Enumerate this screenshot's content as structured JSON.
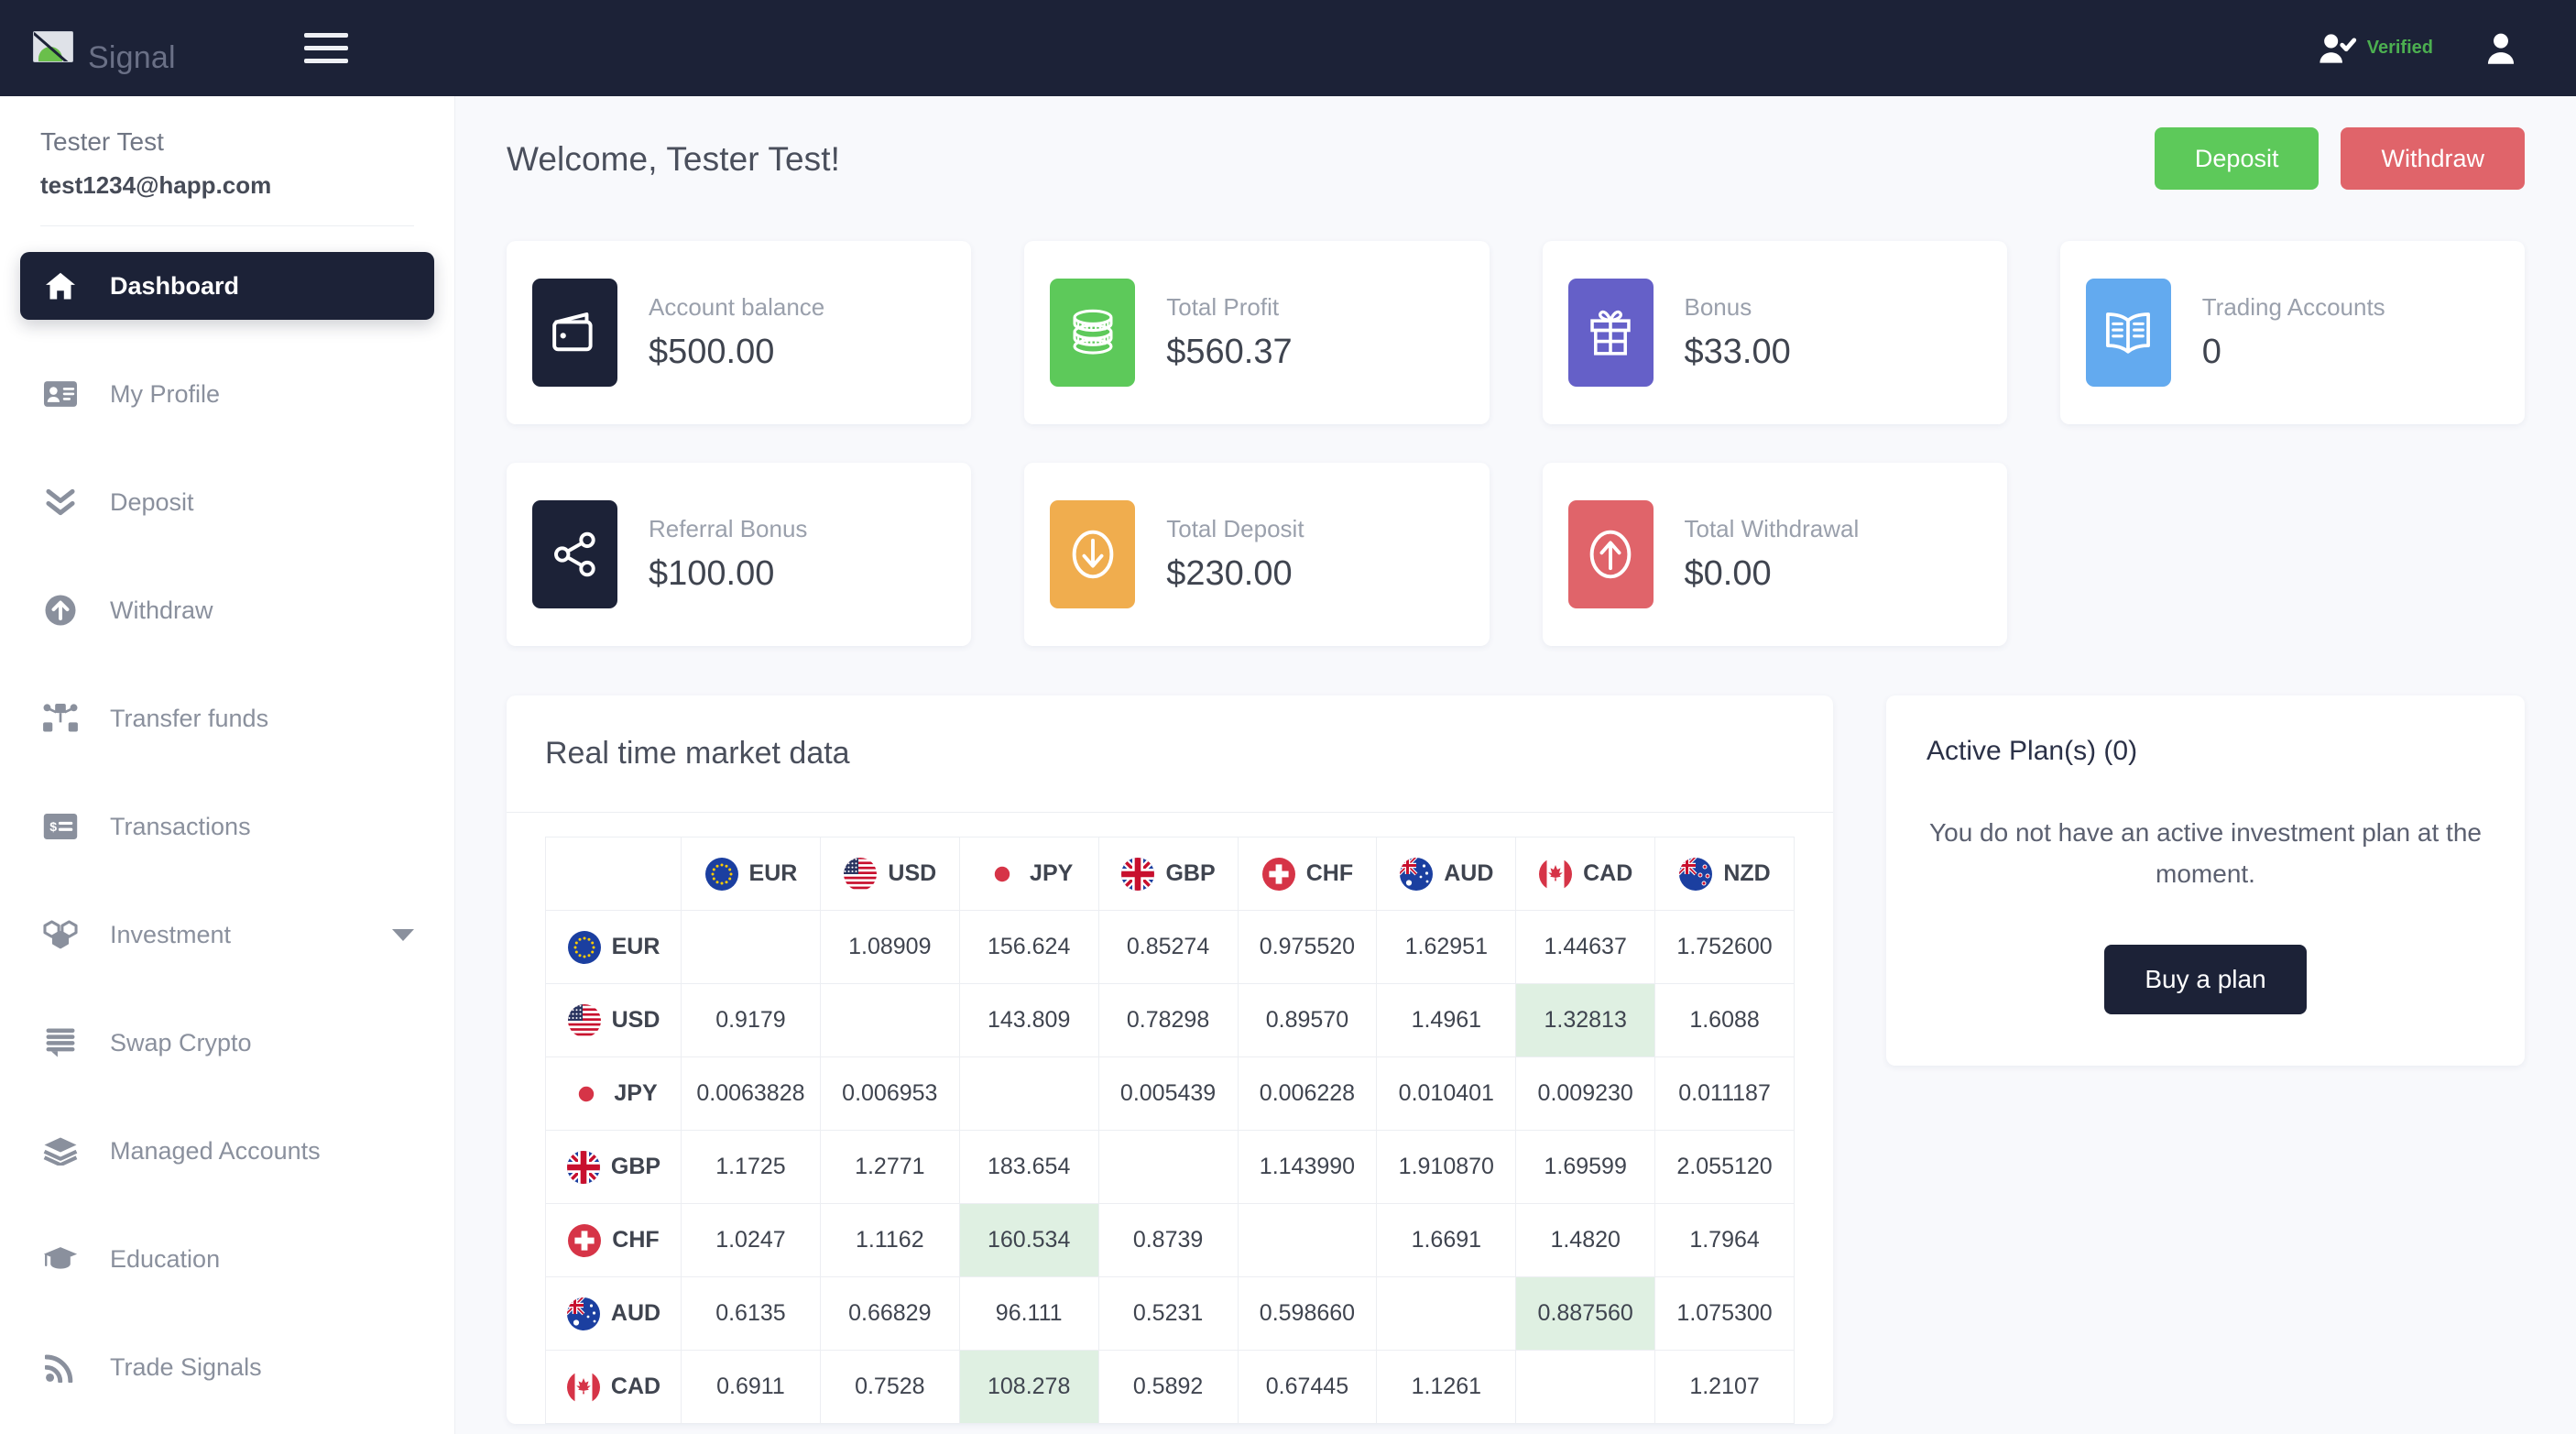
{
  "topbar": {
    "logo_alt": "Signal",
    "logo_icon": "broken-image-icon",
    "menu_icon": "hamburger-menu-icon",
    "verified_label": "Verified",
    "verified_icon": "user-check-icon",
    "account_icon": "user-account-icon"
  },
  "sidebar": {
    "user_name": "Tester Test",
    "user_email": "test1234@happ.com",
    "items": [
      {
        "label": "Dashboard",
        "icon": "home-icon",
        "active": true,
        "caret": false
      },
      {
        "label": "My Profile",
        "icon": "id-card-icon",
        "active": false,
        "caret": false
      },
      {
        "label": "Deposit",
        "icon": "chevrons-down-icon",
        "active": false,
        "caret": false
      },
      {
        "label": "Withdraw",
        "icon": "arrow-up-circle-icon",
        "active": false,
        "caret": false
      },
      {
        "label": "Transfer funds",
        "icon": "transfer-nodes-icon",
        "active": false,
        "caret": false
      },
      {
        "label": "Transactions",
        "icon": "money-card-icon",
        "active": false,
        "caret": false
      },
      {
        "label": "Investment",
        "icon": "boxes-icon",
        "active": false,
        "caret": true
      },
      {
        "label": "Swap Crypto",
        "icon": "stacked-lines-icon",
        "active": false,
        "caret": false
      },
      {
        "label": "Managed Accounts",
        "icon": "layers-icon",
        "active": false,
        "caret": false
      },
      {
        "label": "Education",
        "icon": "graduation-cap-icon",
        "active": false,
        "caret": false
      },
      {
        "label": "Trade Signals",
        "icon": "rss-signal-icon",
        "active": false,
        "caret": false
      }
    ]
  },
  "header": {
    "welcome": "Welcome, Tester Test!",
    "deposit_label": "Deposit",
    "withdraw_label": "Withdraw",
    "deposit_color": "#5dc95a",
    "withdraw_color": "#e0646a"
  },
  "stats": [
    {
      "label": "Account balance",
      "value": "$500.00",
      "icon": "wallet-icon",
      "color": "#1c2237"
    },
    {
      "label": "Total Profit",
      "value": "$560.37",
      "icon": "coins-icon",
      "color": "#5dc95a"
    },
    {
      "label": "Bonus",
      "value": "$33.00",
      "icon": "gift-icon",
      "color": "#6560c8"
    },
    {
      "label": "Trading Accounts",
      "value": "0",
      "icon": "open-book-icon",
      "color": "#63aaef"
    },
    {
      "label": "Referral Bonus",
      "value": "$100.00",
      "icon": "share-nodes-icon",
      "color": "#1c2237"
    },
    {
      "label": "Total Deposit",
      "value": "$230.00",
      "icon": "arrow-down-circle-icon",
      "color": "#f0ad4e"
    },
    {
      "label": "Total Withdrawal",
      "value": "$0.00",
      "icon": "arrow-up-circle-icon",
      "color": "#e0646a"
    }
  ],
  "market": {
    "title": "Real time market data",
    "columns": [
      "",
      "EUR",
      "USD",
      "JPY",
      "GBP",
      "CHF",
      "AUD",
      "CAD",
      "NZD"
    ],
    "rows": [
      {
        "currency": "EUR",
        "values": [
          "",
          "1.08909",
          "156.624",
          "0.85274",
          "0.975520",
          "1.62951",
          "1.44637",
          "1.752600"
        ],
        "highlight": []
      },
      {
        "currency": "USD",
        "values": [
          "0.9179",
          "",
          "143.809",
          "0.78298",
          "0.89570",
          "1.4961",
          "1.32813",
          "1.6088"
        ],
        "highlight": [
          6
        ]
      },
      {
        "currency": "JPY",
        "values": [
          "0.0063828",
          "0.006953",
          "",
          "0.005439",
          "0.006228",
          "0.010401",
          "0.009230",
          "0.011187"
        ],
        "highlight": []
      },
      {
        "currency": "GBP",
        "values": [
          "1.1725",
          "1.2771",
          "183.654",
          "",
          "1.143990",
          "1.910870",
          "1.69599",
          "2.055120"
        ],
        "highlight": []
      },
      {
        "currency": "CHF",
        "values": [
          "1.0247",
          "1.1162",
          "160.534",
          "0.8739",
          "",
          "1.6691",
          "1.4820",
          "1.7964"
        ],
        "highlight": [
          2
        ]
      },
      {
        "currency": "AUD",
        "values": [
          "0.6135",
          "0.66829",
          "96.111",
          "0.5231",
          "0.598660",
          "",
          "0.887560",
          "1.075300"
        ],
        "highlight": [
          6
        ]
      },
      {
        "currency": "CAD",
        "values": [
          "0.6911",
          "0.7528",
          "108.278",
          "0.5892",
          "0.67445",
          "1.1261",
          "",
          "1.2107"
        ],
        "highlight": [
          2
        ]
      }
    ],
    "highlight_color": "#dff0e2"
  },
  "plan": {
    "title": "Active Plan(s) (0)",
    "message": "You do not have an active investment plan at the moment.",
    "button_label": "Buy a plan"
  }
}
